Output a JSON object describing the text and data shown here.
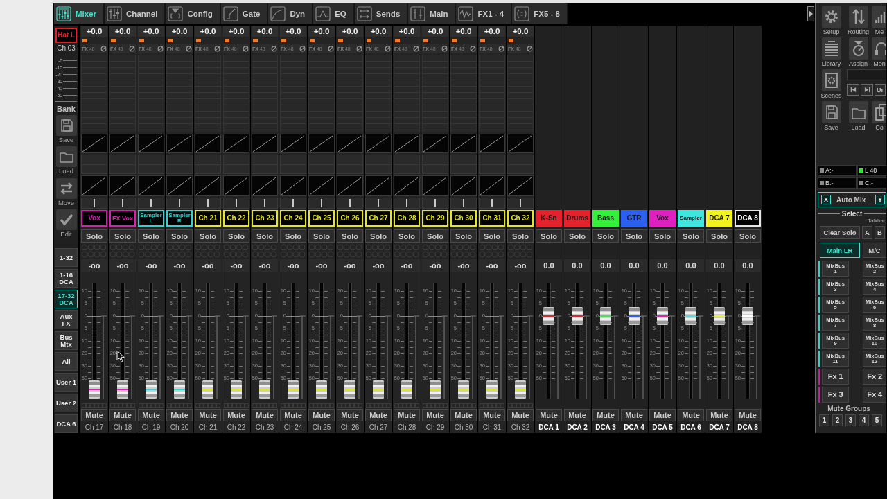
{
  "tabs": [
    {
      "label": "Mixer",
      "selected": true
    },
    {
      "label": "Channel",
      "selected": false
    },
    {
      "label": "Config",
      "selected": false
    },
    {
      "label": "Gate",
      "selected": false
    },
    {
      "label": "Dyn",
      "selected": false
    },
    {
      "label": "EQ",
      "selected": false
    },
    {
      "label": "Sends",
      "selected": false
    },
    {
      "label": "Main",
      "selected": false
    },
    {
      "label": "FX1 - 4",
      "selected": false
    },
    {
      "label": "FX5 - 8",
      "selected": false
    }
  ],
  "sidebar": {
    "selected_channel": {
      "name": "Hat L",
      "color": "#e0202c",
      "number": "Ch 03"
    },
    "meter_scale": [
      "-5",
      "-10",
      "-20",
      "-30",
      "-40",
      "-50"
    ],
    "bank_title": "Bank",
    "bank_buttons": [
      {
        "label": "Save"
      },
      {
        "label": "Load"
      },
      {
        "label": "Move"
      },
      {
        "label": "Edit"
      }
    ],
    "layers": [
      {
        "label": "1-32",
        "selected": false
      },
      {
        "label": "1-16 DCA",
        "selected": false
      },
      {
        "label": "17-32 DCA",
        "selected": true
      },
      {
        "label": "Aux FX",
        "selected": false
      },
      {
        "label": "Bus Mtx",
        "selected": false
      },
      {
        "label": "All",
        "selected": false
      },
      {
        "label": "User 1",
        "selected": false
      },
      {
        "label": "User 2",
        "selected": false
      },
      {
        "label": "DCA 6",
        "selected": false
      }
    ]
  },
  "channels": [
    {
      "gain": "+0.0",
      "fx": "FX",
      "phantom": "48",
      "pan": {
        "level": 0.5
      },
      "name": "Vox",
      "color": "#d61fae",
      "solo": "Solo",
      "value": "-oo",
      "level": 0,
      "scale": [
        "10",
        "5",
        "0",
        "5",
        "10",
        "20",
        "30",
        "50"
      ],
      "mute": "Mute",
      "label": "Ch 17"
    },
    {
      "gain": "+0.0",
      "fx": "FX",
      "phantom": "48",
      "pan": {
        "level": 0.5
      },
      "name": "FX Vox",
      "color": "#d61fae",
      "solo": "Solo",
      "value": "-oo",
      "level": 0,
      "scale": [
        "10",
        "5",
        "0",
        "5",
        "10",
        "20",
        "30",
        "50"
      ],
      "mute": "Mute",
      "label": "Ch 18"
    },
    {
      "gain": "+0.0",
      "fx": "FX",
      "phantom": "48",
      "pan": {
        "level": 0.5
      },
      "name": "Sampler L",
      "color": "#2fd3cf",
      "solo": "Solo",
      "value": "-oo",
      "level": 0,
      "scale": [
        "10",
        "5",
        "0",
        "5",
        "10",
        "20",
        "30",
        "50"
      ],
      "mute": "Mute",
      "label": "Ch 19"
    },
    {
      "gain": "+0.0",
      "fx": "FX",
      "phantom": "48",
      "pan": {
        "level": 0.5
      },
      "name": "Sampler R",
      "color": "#2fd3cf",
      "solo": "Solo",
      "value": "-oo",
      "level": 0,
      "scale": [
        "10",
        "5",
        "0",
        "5",
        "10",
        "20",
        "30",
        "50"
      ],
      "mute": "Mute",
      "label": "Ch 20"
    },
    {
      "gain": "+0.0",
      "fx": "FX",
      "phantom": "48",
      "pan": {
        "level": 0.5
      },
      "name": "Ch 21",
      "color": "#e6e61c",
      "solo": "Solo",
      "value": "-oo",
      "level": 0,
      "scale": [
        "10",
        "5",
        "0",
        "5",
        "10",
        "20",
        "30",
        "50"
      ],
      "mute": "Mute",
      "label": "Ch 21"
    },
    {
      "gain": "+0.0",
      "fx": "FX",
      "phantom": "48",
      "pan": {
        "level": 0.5
      },
      "name": "Ch 22",
      "color": "#e6e61c",
      "solo": "Solo",
      "value": "-oo",
      "level": 0,
      "scale": [
        "10",
        "5",
        "0",
        "5",
        "10",
        "20",
        "30",
        "50"
      ],
      "mute": "Mute",
      "label": "Ch 22"
    },
    {
      "gain": "+0.0",
      "fx": "FX",
      "phantom": "48",
      "pan": {
        "level": 0.5
      },
      "name": "Ch 23",
      "color": "#e6e61c",
      "solo": "Solo",
      "value": "-oo",
      "level": 0,
      "scale": [
        "10",
        "5",
        "0",
        "5",
        "10",
        "20",
        "30",
        "50"
      ],
      "mute": "Mute",
      "label": "Ch 23"
    },
    {
      "gain": "+0.0",
      "fx": "FX",
      "phantom": "48",
      "pan": {
        "level": 0.5
      },
      "name": "Ch 24",
      "color": "#e6e61c",
      "solo": "Solo",
      "value": "-oo",
      "level": 0,
      "scale": [
        "10",
        "5",
        "0",
        "5",
        "10",
        "20",
        "30",
        "50"
      ],
      "mute": "Mute",
      "label": "Ch 24"
    },
    {
      "gain": "+0.0",
      "fx": "FX",
      "phantom": "48",
      "pan": {
        "level": 0.5
      },
      "name": "Ch 25",
      "color": "#e6e61c",
      "solo": "Solo",
      "value": "-oo",
      "level": 0,
      "scale": [
        "10",
        "5",
        "0",
        "5",
        "10",
        "20",
        "30",
        "50"
      ],
      "mute": "Mute",
      "label": "Ch 25"
    },
    {
      "gain": "+0.0",
      "fx": "FX",
      "phantom": "48",
      "pan": {
        "level": 0.5
      },
      "name": "Ch 26",
      "color": "#e6e61c",
      "solo": "Solo",
      "value": "-oo",
      "level": 0,
      "scale": [
        "10",
        "5",
        "0",
        "5",
        "10",
        "20",
        "30",
        "50"
      ],
      "mute": "Mute",
      "label": "Ch 26"
    },
    {
      "gain": "+0.0",
      "fx": "FX",
      "phantom": "48",
      "pan": {
        "level": 0.5
      },
      "name": "Ch 27",
      "color": "#e6e61c",
      "solo": "Solo",
      "value": "-oo",
      "level": 0,
      "scale": [
        "10",
        "5",
        "0",
        "5",
        "10",
        "20",
        "30",
        "50"
      ],
      "mute": "Mute",
      "label": "Ch 27"
    },
    {
      "gain": "+0.0",
      "fx": "FX",
      "phantom": "48",
      "pan": {
        "level": 0.5
      },
      "name": "Ch 28",
      "color": "#e6e61c",
      "solo": "Solo",
      "value": "-oo",
      "level": 0,
      "scale": [
        "10",
        "5",
        "0",
        "5",
        "10",
        "20",
        "30",
        "50"
      ],
      "mute": "Mute",
      "label": "Ch 28"
    },
    {
      "gain": "+0.0",
      "fx": "FX",
      "phantom": "48",
      "pan": {
        "level": 0.5
      },
      "name": "Ch 29",
      "color": "#e6e61c",
      "solo": "Solo",
      "value": "-oo",
      "level": 0,
      "scale": [
        "10",
        "5",
        "0",
        "5",
        "10",
        "20",
        "30",
        "50"
      ],
      "mute": "Mute",
      "label": "Ch 29"
    },
    {
      "gain": "+0.0",
      "fx": "FX",
      "phantom": "48",
      "pan": {
        "level": 0.5
      },
      "name": "Ch 30",
      "color": "#e6e61c",
      "solo": "Solo",
      "value": "-oo",
      "level": 0,
      "scale": [
        "10",
        "5",
        "0",
        "5",
        "10",
        "20",
        "30",
        "50"
      ],
      "mute": "Mute",
      "label": "Ch 30"
    },
    {
      "gain": "+0.0",
      "fx": "FX",
      "phantom": "48",
      "pan": {
        "level": 0.5
      },
      "name": "Ch 31",
      "color": "#e6e61c",
      "solo": "Solo",
      "value": "-oo",
      "level": 0,
      "scale": [
        "10",
        "5",
        "0",
        "5",
        "10",
        "20",
        "30",
        "50"
      ],
      "mute": "Mute",
      "label": "Ch 31"
    },
    {
      "gain": "+0.0",
      "fx": "FX",
      "phantom": "48",
      "pan": {
        "level": 0.5
      },
      "name": "Ch 32",
      "color": "#e6e61c",
      "solo": "Solo",
      "value": "-oo",
      "level": 0,
      "scale": [
        "10",
        "5",
        "0",
        "5",
        "10",
        "20",
        "30",
        "50"
      ],
      "mute": "Mute",
      "label": "Ch 32"
    }
  ],
  "dcas": [
    {
      "name": "K-Sn",
      "color": "#e3222c",
      "solo": "Solo",
      "value": "0.0",
      "level": 0.75,
      "scale": [
        "10",
        "5",
        "0",
        "5",
        "10",
        "20",
        "30",
        "50"
      ],
      "mute": "Mute",
      "label": "DCA 1"
    },
    {
      "name": "Drums",
      "color": "#e3222c",
      "solo": "Solo",
      "value": "0.0",
      "level": 0.75,
      "scale": [
        "10",
        "5",
        "0",
        "5",
        "10",
        "20",
        "30",
        "50"
      ],
      "mute": "Mute",
      "label": "DCA 2"
    },
    {
      "name": "Bass",
      "color": "#35f03a",
      "solo": "Solo",
      "value": "0.0",
      "level": 0.75,
      "scale": [
        "10",
        "5",
        "0",
        "5",
        "10",
        "20",
        "30",
        "50"
      ],
      "mute": "Mute",
      "label": "DCA 3"
    },
    {
      "name": "GTR",
      "color": "#2a5ff0",
      "solo": "Solo",
      "value": "0.0",
      "level": 0.75,
      "scale": [
        "10",
        "5",
        "0",
        "5",
        "10",
        "20",
        "30",
        "50"
      ],
      "mute": "Mute",
      "label": "DCA 4"
    },
    {
      "name": "Vox",
      "color": "#e01fc0",
      "solo": "Solo",
      "value": "0.0",
      "level": 0.75,
      "scale": [
        "10",
        "5",
        "0",
        "5",
        "10",
        "20",
        "30",
        "50"
      ],
      "mute": "Mute",
      "label": "DCA 5"
    },
    {
      "name": "Sampler",
      "color": "#3fe6e0",
      "solo": "Solo",
      "value": "0.0",
      "level": 0.75,
      "scale": [
        "10",
        "5",
        "0",
        "5",
        "10",
        "20",
        "30",
        "50"
      ],
      "mute": "Mute",
      "label": "DCA 6"
    },
    {
      "name": "DCA 7",
      "color": "#f2f21e",
      "solo": "Solo",
      "value": "0.0",
      "level": 0.75,
      "scale": [
        "10",
        "5",
        "0",
        "5",
        "10",
        "20",
        "30",
        "50"
      ],
      "mute": "Mute",
      "label": "DCA 7"
    },
    {
      "name": "DCA 8",
      "color": "#000000",
      "solo": "Solo",
      "value": "0.0",
      "level": 0.75,
      "scale": [
        "10",
        "5",
        "0",
        "5",
        "10",
        "20",
        "30",
        "50"
      ],
      "mute": "Mute",
      "label": "DCA 8"
    }
  ],
  "right_panel": {
    "tools": [
      {
        "label": "Setup"
      },
      {
        "label": "Routing"
      },
      {
        "label": "Me"
      },
      {
        "label": "Library"
      },
      {
        "label": "Assign"
      },
      {
        "label": "Mon"
      },
      {
        "label": "Scenes"
      },
      {
        "label": "Save"
      },
      {
        "label": "Load"
      },
      {
        "label": "Co"
      }
    ],
    "transport_text": "Ur",
    "sources": [
      {
        "label": "A:-",
        "color": "#8c8c8c"
      },
      {
        "label": "L 48",
        "color": "#35e835"
      },
      {
        "label": "B:-",
        "color": "#8c8c8c"
      },
      {
        "label": "C:-",
        "color": "#8c8c8c"
      }
    ],
    "automix": {
      "left": "X",
      "label": "Auto Mix",
      "right": "Y"
    },
    "select_title": "Select",
    "talkback_title": "Talkbac",
    "solo_row": {
      "clear": "Clear Solo",
      "talkback": [
        "A",
        "B"
      ]
    },
    "buses": [
      {
        "label": "Main LR",
        "selected": true
      },
      {
        "label": "M/C",
        "selected": false
      }
    ],
    "send_rows": [
      {
        "kind": "bus",
        "color": "#2fd3c4",
        "buttons": [
          "MixBus 1",
          "MixBus 2"
        ]
      },
      {
        "kind": "bus",
        "color": "#2fd3c4",
        "buttons": [
          "MixBus 3",
          "MixBus 4"
        ]
      },
      {
        "kind": "bus",
        "color": "#2fd3c4",
        "buttons": [
          "MixBus 5",
          "MixBus 6"
        ]
      },
      {
        "kind": "bus",
        "color": "#2fd3c4",
        "buttons": [
          "MixBus 7",
          "MixBus 8"
        ]
      },
      {
        "kind": "bus",
        "color": "#2fd3c4",
        "buttons": [
          "MixBus 9",
          "MixBus 10"
        ]
      },
      {
        "kind": "bus",
        "color": "#2fd3c4",
        "buttons": [
          "MixBus 11",
          "MixBus 12"
        ]
      },
      {
        "kind": "fx",
        "color": "#c41a9c",
        "buttons": [
          "Fx 1",
          "Fx 2"
        ]
      },
      {
        "kind": "fx",
        "color": "#c41a9c",
        "buttons": [
          "Fx 3",
          "Fx 4"
        ]
      }
    ],
    "mute_groups": {
      "title": "Mute Groups",
      "buttons": [
        "1",
        "2",
        "3",
        "4",
        "5"
      ]
    }
  }
}
